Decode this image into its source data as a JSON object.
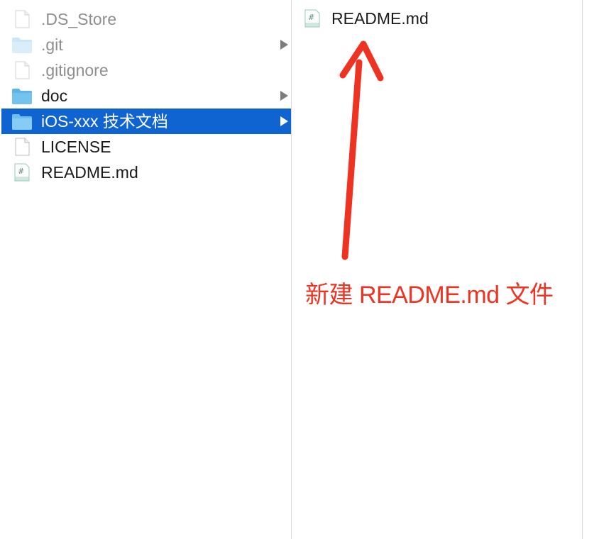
{
  "column1": {
    "items": [
      {
        "name": ".DS_Store",
        "kind": "file",
        "hidden": true
      },
      {
        "name": ".git",
        "kind": "folder",
        "hidden": true
      },
      {
        "name": ".gitignore",
        "kind": "file",
        "hidden": true
      },
      {
        "name": "doc",
        "kind": "folder",
        "hidden": false
      },
      {
        "name": "iOS-xxx 技术文档",
        "kind": "folder",
        "hidden": false,
        "selected": true
      },
      {
        "name": "LICENSE",
        "kind": "file",
        "hidden": false
      },
      {
        "name": "README.md",
        "kind": "markdown",
        "hidden": false
      }
    ]
  },
  "column2": {
    "items": [
      {
        "name": "README.md",
        "kind": "markdown"
      }
    ]
  },
  "annotation": {
    "text": "新建 README.md 文件",
    "color": "#ee3322"
  },
  "colors": {
    "selection": "#0f64d2",
    "folder": "#74c3ef",
    "hidden_text": "#8f8f8f"
  },
  "icons": {
    "file": "blank-document-icon",
    "folder": "folder-icon",
    "markdown": "markdown-file-icon",
    "disclosure": "disclosure-triangle-icon"
  }
}
